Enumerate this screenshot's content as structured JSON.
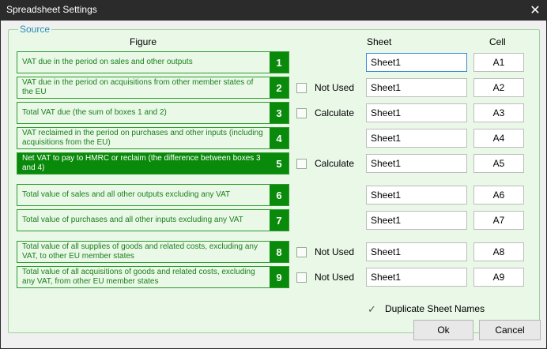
{
  "window": {
    "title": "Spreadsheet Settings",
    "close_glyph": "✕"
  },
  "group": {
    "legend": "Source"
  },
  "headers": {
    "figure": "Figure",
    "sheet": "Sheet",
    "cell": "Cell"
  },
  "rows": [
    {
      "label": "VAT due in the period on sales and other outputs",
      "num": "1",
      "option": "",
      "sheet": "Sheet1",
      "cell": "A1"
    },
    {
      "label": "VAT due in the period on acquisitions from other member states of the EU",
      "num": "2",
      "option": "Not Used",
      "sheet": "Sheet1",
      "cell": "A2"
    },
    {
      "label": "Total VAT due (the sum of boxes 1 and 2)",
      "num": "3",
      "option": "Calculate",
      "sheet": "Sheet1",
      "cell": "A3"
    },
    {
      "label": "VAT reclaimed in the period on purchases and other inputs (including acquisitions from the EU)",
      "num": "4",
      "option": "",
      "sheet": "Sheet1",
      "cell": "A4"
    },
    {
      "label": "Net VAT to pay to HMRC or reclaim (the difference between boxes 3 and 4)",
      "num": "5",
      "option": "Calculate",
      "sheet": "Sheet1",
      "cell": "A5"
    },
    {
      "label": "Total value of sales and all other outputs excluding any VAT",
      "num": "6",
      "option": "",
      "sheet": "Sheet1",
      "cell": "A6"
    },
    {
      "label": "Total value of purchases and all other inputs excluding any VAT",
      "num": "7",
      "option": "",
      "sheet": "Sheet1",
      "cell": "A7"
    },
    {
      "label": "Total value of all supplies of goods and related costs, excluding any VAT, to other EU member states",
      "num": "8",
      "option": "Not Used",
      "sheet": "Sheet1",
      "cell": "A8"
    },
    {
      "label": "Total value of all acquisitions of goods and related costs, excluding any VAT, from other EU member states",
      "num": "9",
      "option": "Not Used",
      "sheet": "Sheet1",
      "cell": "A9"
    }
  ],
  "duplicate": {
    "label": "Duplicate Sheet Names",
    "check_glyph": "✓"
  },
  "buttons": {
    "ok": "Ok",
    "cancel": "Cancel"
  }
}
